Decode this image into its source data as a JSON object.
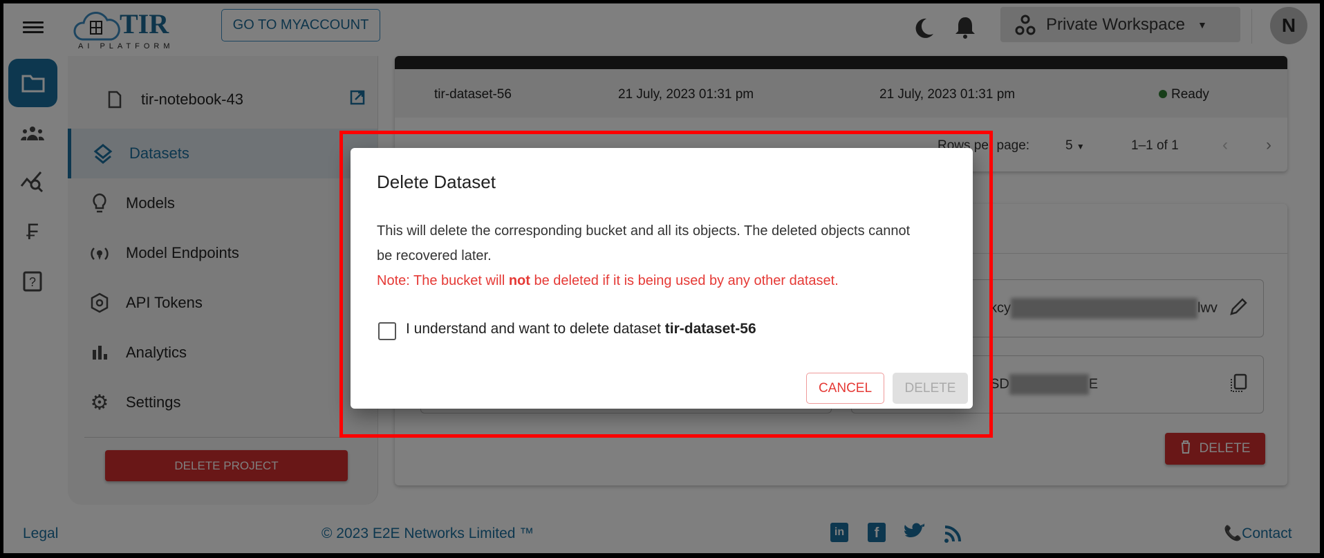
{
  "header": {
    "logo_text": "TIR",
    "logo_sub": "AI PLATFORM",
    "myaccount_label": "GO TO MYACCOUNT",
    "workspace_label": "Private Workspace",
    "avatar_initial": "N"
  },
  "rail": {
    "icons": [
      "folder-icon",
      "team-icon",
      "monitoring-icon",
      "billing-icon",
      "help-icon"
    ]
  },
  "sidebar": {
    "notebook": "tir-notebook-43",
    "items": [
      {
        "label": "Datasets",
        "active": true
      },
      {
        "label": "Models"
      },
      {
        "label": "Model Endpoints"
      },
      {
        "label": "API Tokens"
      },
      {
        "label": "Analytics"
      },
      {
        "label": "Settings"
      }
    ],
    "delete_project_label": "DELETE PROJECT"
  },
  "table": {
    "rows": [
      {
        "name": "tir-dataset-56",
        "created": "21 July, 2023 01:31 pm",
        "updated": "21 July, 2023 01:31 pm",
        "status": "Ready"
      }
    ],
    "rows_per_page_label": "Rows per page:",
    "rows_per_page": "5",
    "range": "1–1 of 1"
  },
  "details": {
    "field1_prefix": "kcy",
    "field1_suffix": "lwv",
    "field2_prefix": "SD",
    "field2_suffix": "E",
    "delete_label": "DELETE"
  },
  "footer": {
    "legal": "Legal",
    "copyright": "© 2023 E2E Networks Limited ™",
    "contact": "Contact"
  },
  "modal": {
    "title": "Delete Dataset",
    "body": "This will delete the corresponding bucket and all its objects. The deleted objects cannot be recovered later.",
    "note_before": "Note: The bucket will ",
    "note_bold": "not",
    "note_after": " be deleted if it is being used by any other dataset.",
    "checkbox_label": "I understand and want to delete dataset ",
    "dataset_name": "tir-dataset-56",
    "checked": false,
    "cancel_label": "CANCEL",
    "delete_label": "DELETE"
  },
  "colors": {
    "brand": "#1a6f9e",
    "danger": "#d32f2f",
    "status_ready": "#2e7d32"
  }
}
